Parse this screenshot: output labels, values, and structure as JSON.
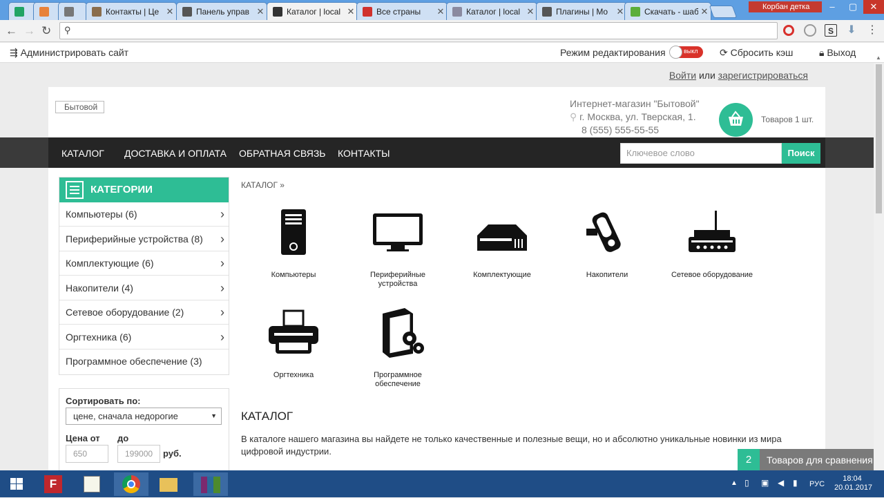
{
  "browser": {
    "tabs": [
      {
        "label": "",
        "icon": "sheets-icon"
      },
      {
        "label": "",
        "icon": "fox-icon"
      },
      {
        "label": "",
        "icon": "sync-icon"
      },
      {
        "label": "Контакты | Це",
        "icon": "page-icon"
      },
      {
        "label": "Панель управ",
        "icon": "elephant-icon"
      },
      {
        "label": "Каталог | local",
        "icon": "elephant-icon"
      },
      {
        "label": "Все страны",
        "icon": "pdf-icon"
      },
      {
        "label": "Каталог | local",
        "icon": "cat-icon"
      },
      {
        "label": "Плагины | Mo",
        "icon": "elephant-icon"
      },
      {
        "label": "Скачать - шаб",
        "icon": "leaf-icon"
      }
    ],
    "profile_name": "Корбан детка",
    "address_value": ""
  },
  "adminbar": {
    "admin_label": "Администрировать сайт",
    "edit_mode_label": "Режим редактирования",
    "toggle_label": "выкл",
    "clear_cache_label": "Сбросить кэш",
    "logout_label": "Выход"
  },
  "site": {
    "login_label": "Войти",
    "or_label": "или",
    "register_label": "зарегистрироваться",
    "logo_alt": "Бытовой",
    "shop_name": "Интернет-магазин \"Бытовой\"",
    "address": "г. Москва, ул. Тверская, 1.",
    "phone": "8 (555) 555-55-55",
    "cart_label": "Товаров 1 шт.",
    "accent_color": "#2ebd95",
    "nav": [
      "КАТАЛОГ",
      "ДОСТАВКА И ОПЛАТА",
      "ОБРАТНАЯ СВЯЗЬ",
      "КОНТАКТЫ"
    ],
    "search_placeholder": "Ключевое слово",
    "search_button": "Поиск"
  },
  "sidebar": {
    "title": "КАТЕГОРИИ",
    "items": [
      {
        "label": "Компьютеры (6)",
        "has_children": true
      },
      {
        "label": "Периферийные устройства (8)",
        "has_children": true
      },
      {
        "label": "Комплектующие (6)",
        "has_children": true
      },
      {
        "label": "Накопители (4)",
        "has_children": true
      },
      {
        "label": "Сетевое оборудование (2)",
        "has_children": true
      },
      {
        "label": "Оргтехника (6)",
        "has_children": true
      },
      {
        "label": "Программное обеспечение (3)",
        "has_children": false
      }
    ],
    "sort_label": "Сортировать по:",
    "sort_value": "цене, сначала недорогие",
    "price_from_label": "Цена от",
    "price_to_label": "до",
    "price_from": "650",
    "price_to": "199000",
    "currency": "руб."
  },
  "main": {
    "breadcrumb": "КАТАЛОГ »",
    "categories": [
      {
        "name": "Компьютеры",
        "icon": "computer-tower-icon"
      },
      {
        "name": "Периферийные устройства",
        "icon": "monitor-icon"
      },
      {
        "name": "Комплектующие",
        "icon": "drive-icon"
      },
      {
        "name": "Накопители",
        "icon": "usb-flash-icon"
      },
      {
        "name": "Сетевое оборудование",
        "icon": "router-icon"
      },
      {
        "name": "Оргтехника",
        "icon": "printer-icon"
      },
      {
        "name": "Программное обеспечение",
        "icon": "software-box-icon"
      }
    ],
    "heading": "КАТАЛОГ",
    "description": "В каталоге нашего магазина вы найдете не только качественные и полезные вещи, но и абсолютно уникальные новинки из мира цифровой индустрии."
  },
  "compare": {
    "count": "2",
    "label": "Товаров для сравнения"
  },
  "taskbar": {
    "lang": "РУС",
    "time": "18:04",
    "date": "20.01.2017"
  }
}
